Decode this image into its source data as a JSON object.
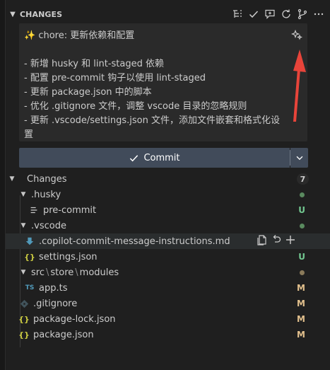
{
  "section": {
    "title": "CHANGES"
  },
  "header_icons": [
    "list-tree-icon",
    "check-icon",
    "comment-sparkle-icon",
    "refresh-icon",
    "branch-icon",
    "more-icon"
  ],
  "commit_message": {
    "subject": "✨ chore: 更新依赖和配置",
    "lines": [
      "- 新增 husky 和 lint-staged 依赖",
      "- 配置 pre-commit 钩子以使用 lint-staged",
      "- 更新 package.json 中的脚本",
      "- 优化 .gitignore 文件，调整 vscode 目录的忽略规则",
      "- 更新 .vscode/settings.json 文件，添加文件嵌套和格式化设",
      "置"
    ]
  },
  "commit_button": {
    "label": "Commit"
  },
  "changes": {
    "label": "Changes",
    "count": "7",
    "items": [
      {
        "label": ".husky",
        "type": "folder",
        "badge": ""
      },
      {
        "label": "pre-commit",
        "type": "file",
        "badge": "U"
      },
      {
        "label": ".vscode",
        "type": "folder",
        "badge": ""
      },
      {
        "label": ".copilot-commit-message-instructions.md",
        "type": "file",
        "badge": ""
      },
      {
        "label": "settings.json",
        "type": "file",
        "badge": "U"
      },
      {
        "folder_path": [
          "src",
          "store",
          "modules"
        ],
        "type": "folder",
        "badge": ""
      },
      {
        "label": "app.ts",
        "type": "file",
        "badge": "M"
      },
      {
        "label": ".gitignore",
        "type": "file",
        "badge": "M"
      },
      {
        "label": "package-lock.json",
        "type": "file",
        "badge": "M"
      },
      {
        "label": "package.json",
        "type": "file",
        "badge": "M"
      }
    ]
  },
  "colors": {
    "untracked": "#73c991",
    "modified": "#e2c08d",
    "commit_button": "#414b5a",
    "annotation_arrow": "#e8443a"
  }
}
